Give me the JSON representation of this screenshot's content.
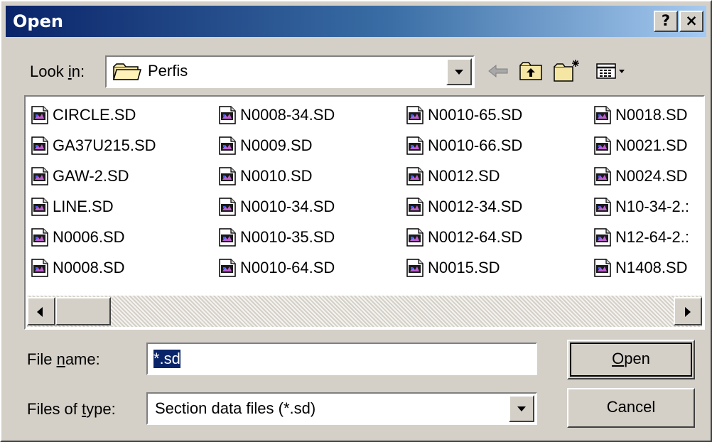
{
  "window": {
    "title": "Open",
    "help_label": "?",
    "close_label": "×"
  },
  "look_in": {
    "label_pre": "Look ",
    "label_accel": "i",
    "label_post": "n:",
    "value": "Perfis"
  },
  "toolbar": {
    "icons": [
      "back-arrow-icon",
      "up-one-level-icon",
      "create-new-folder-icon",
      "view-menu-icon"
    ]
  },
  "file_list": {
    "columns": [
      [
        "CIRCLE.SD",
        "GA37U215.SD",
        "GAW-2.SD",
        "LINE.SD",
        "N0006.SD",
        "N0008.SD"
      ],
      [
        "N0008-34.SD",
        "N0009.SD",
        "N0010.SD",
        "N0010-34.SD",
        "N0010-35.SD",
        "N0010-64.SD"
      ],
      [
        "N0010-65.SD",
        "N0010-66.SD",
        "N0012.SD",
        "N0012-34.SD",
        "N0012-64.SD",
        "N0015.SD"
      ],
      [
        "N0018.SD",
        "N0021.SD",
        "N0024.SD",
        "N10-34-2.:",
        "N12-64-2.:",
        "N1408.SD"
      ]
    ]
  },
  "file_name": {
    "label_pre": "File ",
    "label_accel": "n",
    "label_post": "ame:",
    "value": "*.sd"
  },
  "files_of_type": {
    "label_pre": "Files of ",
    "label_accel": "t",
    "label_post": "ype:",
    "value": "Section data files (*.sd)"
  },
  "buttons": {
    "open_accel": "O",
    "open_rest": "pen",
    "cancel": "Cancel"
  },
  "colors": {
    "face": "#d4d0c8",
    "title_active": "#0a246a",
    "selection": "#0a246a"
  }
}
